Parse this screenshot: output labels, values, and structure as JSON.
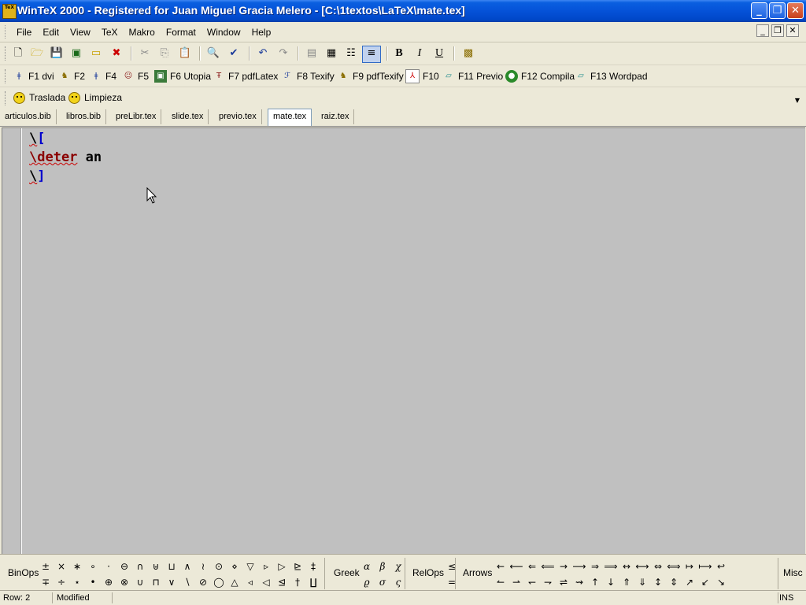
{
  "window": {
    "title": "WinTeX 2000 - Registered for Juan Miguel Gracia Melero - [C:\\1textos\\LaTeX\\mate.tex]",
    "app_icon_text": "TeX"
  },
  "menu": {
    "items": [
      "File",
      "Edit",
      "View",
      "TeX",
      "Makro",
      "Format",
      "Window",
      "Help"
    ]
  },
  "toolbar": {
    "bold_label": "B",
    "italic_label": "I",
    "underline_label": "U"
  },
  "function_keys": [
    {
      "label": "F1 dvi",
      "icon": "dvi-icon"
    },
    {
      "label": "F2",
      "icon": "lion-icon"
    },
    {
      "label": "F4",
      "icon": "dvips-icon"
    },
    {
      "label": "F5",
      "icon": "people-icon"
    },
    {
      "label": "F6 Utopia",
      "icon": "image-icon"
    },
    {
      "label": "F7 pdfLatex",
      "icon": "pdf-tex-icon"
    },
    {
      "label": "F8 Texify",
      "icon": "texify-icon"
    },
    {
      "label": "F9 pdfTexify",
      "icon": "pdftexify-icon"
    },
    {
      "label": "F10",
      "icon": "acrobat-icon"
    },
    {
      "label": "F11 Previo",
      "icon": "preview-icon"
    },
    {
      "label": "F12 Compila",
      "icon": "compile-icon"
    },
    {
      "label": "F13 Wordpad",
      "icon": "wordpad-icon"
    }
  ],
  "macros": [
    {
      "label": "Traslada"
    },
    {
      "label": "Limpieza"
    }
  ],
  "tabs": [
    {
      "label": "articulos.bib"
    },
    {
      "label": "libros.bib"
    },
    {
      "label": "preLibr.tex"
    },
    {
      "label": "slide.tex"
    },
    {
      "label": "previo.tex"
    },
    {
      "label": "mate.tex",
      "active": true
    },
    {
      "label": "raiz.tex"
    }
  ],
  "editor": {
    "line1": {
      "bs": "\\",
      "br": "["
    },
    "line2": {
      "cmd": "\\deter",
      "text": " an"
    },
    "line3": {
      "bs": "\\",
      "br": "]"
    }
  },
  "palette": {
    "binops_label": "BinOps",
    "binops": [
      "±",
      "∓",
      "×",
      "÷",
      "∗",
      "⋆",
      "∘",
      "•",
      "·",
      "⊕",
      "⊖",
      "⊗",
      "∩",
      "∪",
      "⊎",
      "⊓",
      "⊔",
      "∨",
      "∧",
      "∖",
      "≀",
      "⊘",
      "⊙",
      "◯",
      "⋄",
      "△",
      "▽",
      "◃",
      "▹",
      "◁",
      "▷",
      "⊴",
      "⊵",
      "†",
      "‡",
      "∐"
    ],
    "greek_label": "Greek",
    "greek": [
      "α",
      "ϱ",
      "β",
      "σ",
      "χ",
      "ς"
    ],
    "relops_label": "RelOps",
    "relops": [
      "≤",
      "="
    ],
    "arrows_label": "Arrows",
    "arrows": [
      "←",
      "↼",
      "⟵",
      "⇀",
      "⇐",
      "↽",
      "⟸",
      "⇁",
      "→",
      "⇌",
      "⟶",
      "⇝",
      "⇒",
      "↑",
      "⟹",
      "↓",
      "↔",
      "⇑",
      "⟷",
      "⇓",
      "⇔",
      "↕",
      "⟺",
      "⇕",
      "↦",
      "↗",
      "⟼",
      "↙",
      "↩",
      "↘"
    ],
    "misc_label": "Misc"
  },
  "status": {
    "row": "Row: 2",
    "modified": "Modified",
    "mode": "INS"
  }
}
